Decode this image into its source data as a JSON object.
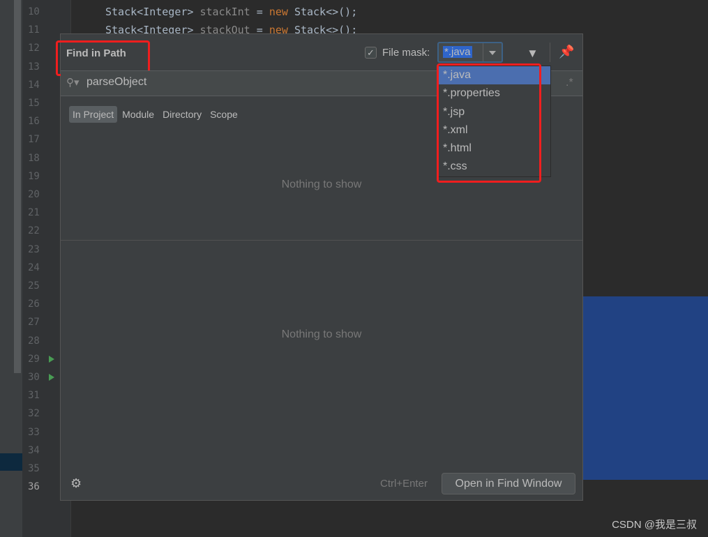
{
  "editor": {
    "line_numbers": [
      "10",
      "11",
      "12",
      "13",
      "14",
      "15",
      "16",
      "17",
      "18",
      "19",
      "20",
      "21",
      "22",
      "23",
      "24",
      "25",
      "26",
      "27",
      "28",
      "29",
      "30",
      "31",
      "32",
      "33",
      "34",
      "35",
      "36"
    ],
    "current_line": "36",
    "run_lines": [
      "29",
      "30"
    ],
    "code": [
      {
        "type": "Stack<Integer>",
        "var": "stackInt",
        "eq": "=",
        "kw": "new",
        "ctor": "Stack<>();"
      },
      {
        "type": "Stack<Integer>",
        "var": "stackOut",
        "eq": "=",
        "kw": "new",
        "ctor": "Stack<>();"
      }
    ]
  },
  "dialog": {
    "title": "Find in Path",
    "file_mask_checked": true,
    "file_mask_label": "File mask:",
    "file_mask_value": "*.java",
    "search_value": "parseObject",
    "regex_icon": ".*",
    "scopes": [
      "In Project",
      "Module",
      "Directory",
      "Scope"
    ],
    "selected_scope": "In Project",
    "results_empty": "Nothing to show",
    "preview_empty": "Nothing to show",
    "shortcut_hint": "Ctrl+Enter",
    "open_button": "Open in Find Window",
    "mask_options": [
      "*.java",
      "*.properties",
      "*.jsp",
      "*.xml",
      "*.html",
      "*.css"
    ],
    "selected_option": "*.java"
  },
  "watermark": "CSDN @我是三叔",
  "colors": {
    "highlight_box": "#f01e1e",
    "selection": "#4b6eaf",
    "editor_bg": "#2b2b2b",
    "dialog_bg": "#3c3f41"
  }
}
